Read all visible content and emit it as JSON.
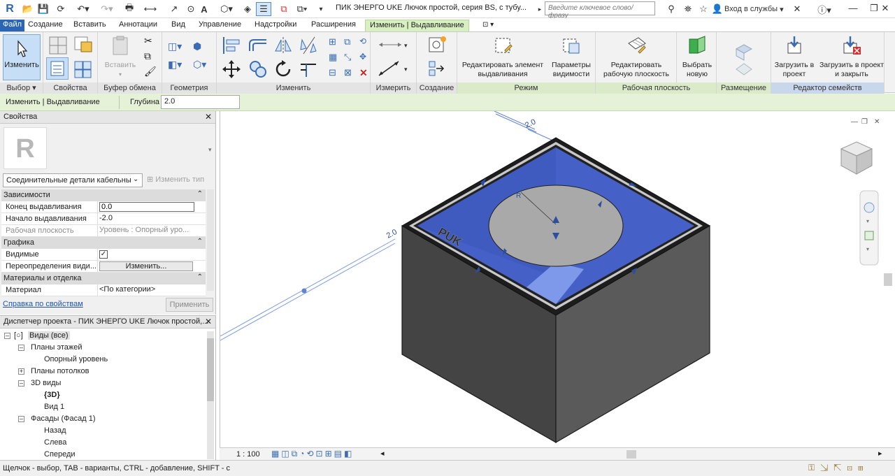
{
  "app": {
    "logo": "R",
    "file_tab": "Файл",
    "doc_title": "ПИК ЭНЕРГО UKE Лючок простой, серия BS, с тубу...",
    "search_placeholder": "Введите ключевое слово/фразу",
    "login_label": "Вход в службы"
  },
  "tabs": [
    "Создание",
    "Вставить",
    "Аннотации",
    "Вид",
    "Управление",
    "Надстройки",
    "Расширения",
    "Изменить | Выдавливание"
  ],
  "ribbon": {
    "modify_label": "Изменить",
    "paste_label": "Вставить",
    "panels": {
      "select": "Выбор ▾",
      "properties": "Свойства",
      "clipboard": "Буфер обмена",
      "geometry": "Геометрия",
      "modify": "Изменить",
      "measure": "Измерить",
      "create": "Создание",
      "mode": "Режим",
      "workplane": "Рабочая плоскость",
      "placement": "Размещение",
      "family_editor": "Редактор семейств"
    },
    "buttons": {
      "edit_extrusion": "Редактировать элемент выдавливания",
      "visibility": "Параметры видимости",
      "edit_workplane": "Редактировать рабочую плоскость",
      "pick_new": "Выбрать новую",
      "load_project": "Загрузить в проект",
      "load_close": "Загрузить в проект и закрыть"
    }
  },
  "options_bar": {
    "context": "Изменить | Выдавливание",
    "depth_label": "Глубина",
    "depth_value": "2.0"
  },
  "properties": {
    "title": "Свойства",
    "type_name": "Соединительные детали кабельны",
    "edit_type": "Изменить тип",
    "groups": {
      "constraints": "Зависимости",
      "graphics": "Графика",
      "materials": "Материалы и отделка"
    },
    "rows": {
      "extrusion_end": {
        "name": "Конец выдавливания",
        "value": "0.0"
      },
      "extrusion_start": {
        "name": "Начало выдавливания",
        "value": "-2.0"
      },
      "work_plane": {
        "name": "Рабочая плоскость",
        "value": "Уровень : Опорный уро..."
      },
      "visible": {
        "name": "Видимые",
        "value": "✓"
      },
      "visibility_override": {
        "name": "Переопределения види...",
        "value": "Изменить..."
      },
      "material": {
        "name": "Материал",
        "value": "<По категории>"
      }
    },
    "help_link": "Справка по свойствам",
    "apply": "Применить"
  },
  "browser": {
    "title": "Диспетчер проекта - ПИК ЭНЕРГО UKE Лючок простой,...",
    "nodes": {
      "views_all": "Виды (все)",
      "floor_plans": "Планы этажей",
      "ref_level": "Опорный уровень",
      "ceiling_plans": "Планы потолков",
      "views_3d": "3D виды",
      "view_3d": "{3D}",
      "view1": "Вид 1",
      "elevations": "Фасады (Фасад 1)",
      "back": "Назад",
      "left": "Слева",
      "front": "Спереди"
    }
  },
  "viewport": {
    "dim_top": "2.0",
    "dim_left": "2.0",
    "label_text": "PUK",
    "scale": "1 : 100"
  },
  "status_text": "Щелчок - выбор, TAB - варианты, CTRL - добавление, SHIFT - с",
  "colors": {
    "box_fill": "#4a4a4a",
    "blue_face": "#4561c8",
    "selected_face": "#7e98ea",
    "circle_fill": "#a9a9a9",
    "accent": "#2a66b5"
  }
}
